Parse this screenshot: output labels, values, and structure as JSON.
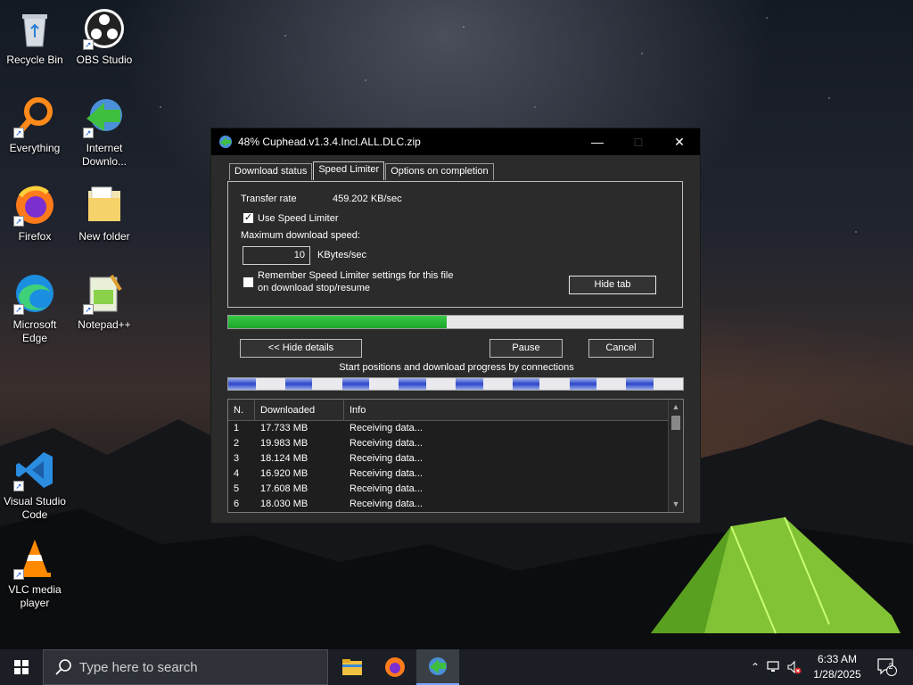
{
  "desktop": {
    "icons": [
      {
        "label": "Recycle Bin",
        "icon": "recycle-bin-icon"
      },
      {
        "label": "OBS Studio",
        "icon": "obs-icon"
      },
      {
        "label": "Everything",
        "icon": "everything-search-icon"
      },
      {
        "label": "Internet Downlo...",
        "icon": "idm-icon"
      },
      {
        "label": "Firefox",
        "icon": "firefox-icon"
      },
      {
        "label": "New folder",
        "icon": "folder-icon"
      },
      {
        "label": "Microsoft Edge",
        "icon": "edge-icon"
      },
      {
        "label": "Notepad++",
        "icon": "notepadpp-icon"
      },
      {
        "label": "Visual Studio Code",
        "icon": "vscode-icon"
      },
      {
        "label": "VLC media player",
        "icon": "vlc-icon"
      }
    ]
  },
  "window": {
    "title": "48% Cuphead.v1.3.4.Incl.ALL.DLC.zip",
    "tabs": [
      "Download status",
      "Speed Limiter",
      "Options on completion"
    ],
    "active_tab": "Speed Limiter",
    "speed_limiter": {
      "transfer_rate_label": "Transfer rate",
      "transfer_rate_value": "459.202  KB/sec",
      "use_limiter_label": "Use Speed Limiter",
      "use_limiter_checked": true,
      "max_speed_label": "Maximum download speed:",
      "max_speed_value": "10",
      "max_speed_unit": "KBytes/sec",
      "remember_label_1": "Remember Speed Limiter settings for this file",
      "remember_label_2": "on download stop/resume",
      "remember_checked": false,
      "hide_tab_label": "Hide tab"
    },
    "progress_percent": 48,
    "hide_details_label": "<< Hide details",
    "pause_label": "Pause",
    "cancel_label": "Cancel",
    "connections_caption": "Start positions and download progress by connections",
    "connection_progress": [
      0.48,
      0.48,
      0.48,
      0.48,
      0.48,
      0.48,
      0.48,
      0.48
    ],
    "table": {
      "columns": [
        "N.",
        "Downloaded",
        "Info"
      ],
      "rows": [
        {
          "n": "1",
          "downloaded": "17.733  MB",
          "info": "Receiving data..."
        },
        {
          "n": "2",
          "downloaded": "19.983  MB",
          "info": "Receiving data..."
        },
        {
          "n": "3",
          "downloaded": "18.124  MB",
          "info": "Receiving data..."
        },
        {
          "n": "4",
          "downloaded": "16.920  MB",
          "info": "Receiving data..."
        },
        {
          "n": "5",
          "downloaded": "17.608  MB",
          "info": "Receiving data..."
        },
        {
          "n": "6",
          "downloaded": "18.030  MB",
          "info": "Receiving data..."
        }
      ]
    }
  },
  "taskbar": {
    "search_placeholder": "Type here to search",
    "apps": [
      "file-explorer-icon",
      "firefox-icon",
      "idm-icon"
    ],
    "time": "6:33 AM",
    "date": "1/28/2025",
    "notification_count": "2"
  },
  "colors": {
    "progress": "#1da52c",
    "connection": "#2b45c9"
  }
}
